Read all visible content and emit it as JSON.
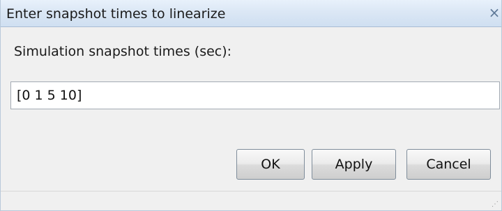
{
  "window": {
    "title": "Enter snapshot times to linearize",
    "close_icon": "close-icon"
  },
  "form": {
    "label": "Simulation snapshot times (sec):",
    "input_value": "[0 1 5 10]"
  },
  "buttons": {
    "ok": "OK",
    "apply": "Apply",
    "cancel": "Cancel"
  },
  "colors": {
    "titlebar": "#dbe7f5",
    "close_glyph": "#5d7897",
    "dialog_background": "#f0f0f0"
  }
}
